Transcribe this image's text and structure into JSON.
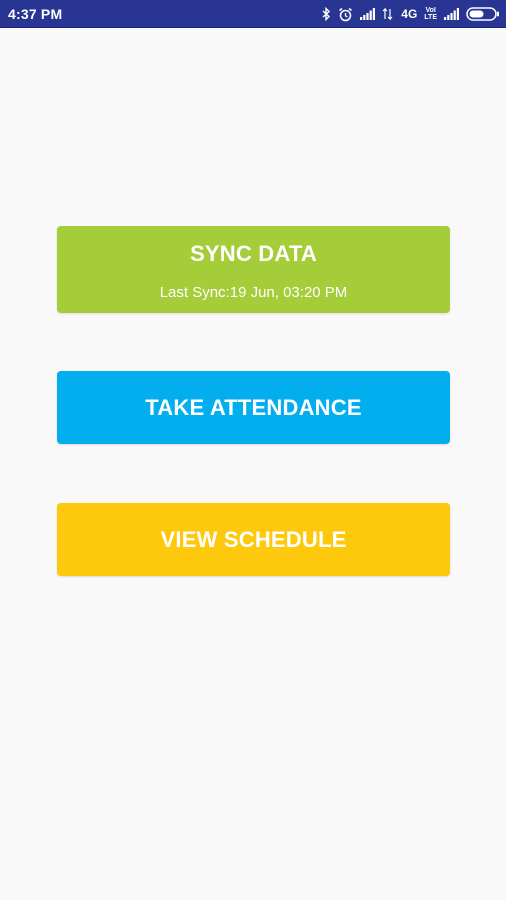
{
  "status_bar": {
    "time": "4:37 PM",
    "network": "4G",
    "network_sub_top": "VoI",
    "network_sub_bottom": "LTE",
    "icons": [
      "bluetooth-icon",
      "alarm-icon",
      "signal-icon",
      "signal-low-icon",
      "signal-icon",
      "battery-icon"
    ],
    "background": "#283593"
  },
  "buttons": {
    "sync": {
      "label": "SYNC DATA",
      "last_sync": "Last Sync:19 Jun, 03:20 PM",
      "color": "#a5cd39"
    },
    "attendance": {
      "label": "TAKE ATTENDANCE",
      "color": "#03aeef"
    },
    "schedule": {
      "label": "VIEW SCHEDULE",
      "color": "#fec90d"
    }
  }
}
